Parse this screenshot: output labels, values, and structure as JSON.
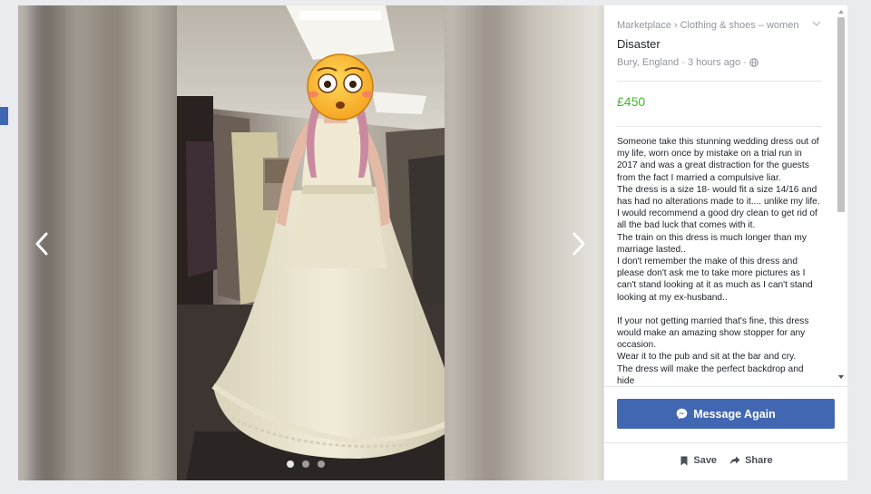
{
  "breadcrumb": {
    "root": "Marketplace",
    "separator": "›",
    "category": "Clothing & shoes – women"
  },
  "listing": {
    "title": "Disaster",
    "location": "Bury, England",
    "dot": "·",
    "posted": "3 hours ago",
    "price": "£450",
    "description": [
      "Someone take this stunning wedding dress out of my life, worn once by mistake on a trial run in 2017 and was a great distraction for the guests from the fact I married a compulsive liar.",
      "The dress is a size 18- would fit a size 14/16 and has had no alterations made to it.... unlike my life.",
      "I would recommend a good dry clean to get rid of all the bad luck that comes with it.",
      "The train on this dress is much longer than my marriage lasted..",
      "I don't remember the make of this dress and please don't ask me to take more pictures as I can't stand looking at it as much as I can't stand looking at my ex-husband..",
      "",
      "If your not getting married that's fine, this dress would make an amazing show stopper for any occasion.",
      "Wear it to the pub and sit at the bar and cry.",
      "The dress will make the perfect backdrop and hide"
    ]
  },
  "actions": {
    "message_label": "Message Again",
    "save_label": "Save",
    "share_label": "Share"
  },
  "viewer": {
    "total_photos": 3,
    "current_photo": 1
  },
  "colors": {
    "accent": "#4267b2",
    "price": "#42b72a",
    "muted_text": "#90949c"
  },
  "icons": {
    "prev": "chevron-left-icon",
    "next": "chevron-right-icon",
    "menu": "chevron-down-icon",
    "privacy": "globe-icon",
    "messenger": "messenger-icon",
    "save": "bookmark-icon",
    "share": "share-arrow-icon"
  }
}
